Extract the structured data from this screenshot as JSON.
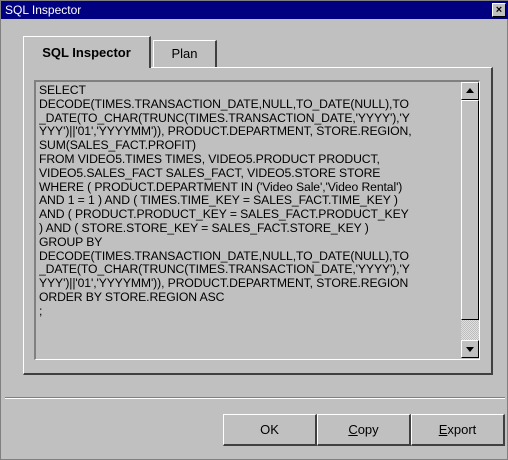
{
  "window": {
    "title": "SQL Inspector",
    "close_glyph": "×"
  },
  "tabs": [
    {
      "label": "SQL Inspector",
      "active": true
    },
    {
      "label": "Plan",
      "active": false
    }
  ],
  "sql": {
    "text": "SELECT\nDECODE(TIMES.TRANSACTION_DATE,NULL,TO_DATE(NULL),TO\n_DATE(TO_CHAR(TRUNC(TIMES.TRANSACTION_DATE,'YYYY'),'Y\nYYY')||'01','YYYYMM')), PRODUCT.DEPARTMENT, STORE.REGION,\nSUM(SALES_FACT.PROFIT)\nFROM VIDEO5.TIMES TIMES, VIDEO5.PRODUCT PRODUCT,\nVIDEO5.SALES_FACT SALES_FACT, VIDEO5.STORE STORE\nWHERE ( PRODUCT.DEPARTMENT IN ('Video Sale','Video Rental')\nAND 1 = 1 ) AND ( TIMES.TIME_KEY = SALES_FACT.TIME_KEY )\nAND ( PRODUCT.PRODUCT_KEY = SALES_FACT.PRODUCT_KEY\n) AND ( STORE.STORE_KEY = SALES_FACT.STORE_KEY )\nGROUP BY\nDECODE(TIMES.TRANSACTION_DATE,NULL,TO_DATE(NULL),TO\n_DATE(TO_CHAR(TRUNC(TIMES.TRANSACTION_DATE,'YYYY'),'Y\nYYY')||'01','YYYYMM')), PRODUCT.DEPARTMENT, STORE.REGION\nORDER BY STORE.REGION ASC\n;"
  },
  "buttons": {
    "ok": "OK",
    "copy_first": "C",
    "copy_rest": "opy",
    "export_first": "E",
    "export_rest": "xport"
  }
}
